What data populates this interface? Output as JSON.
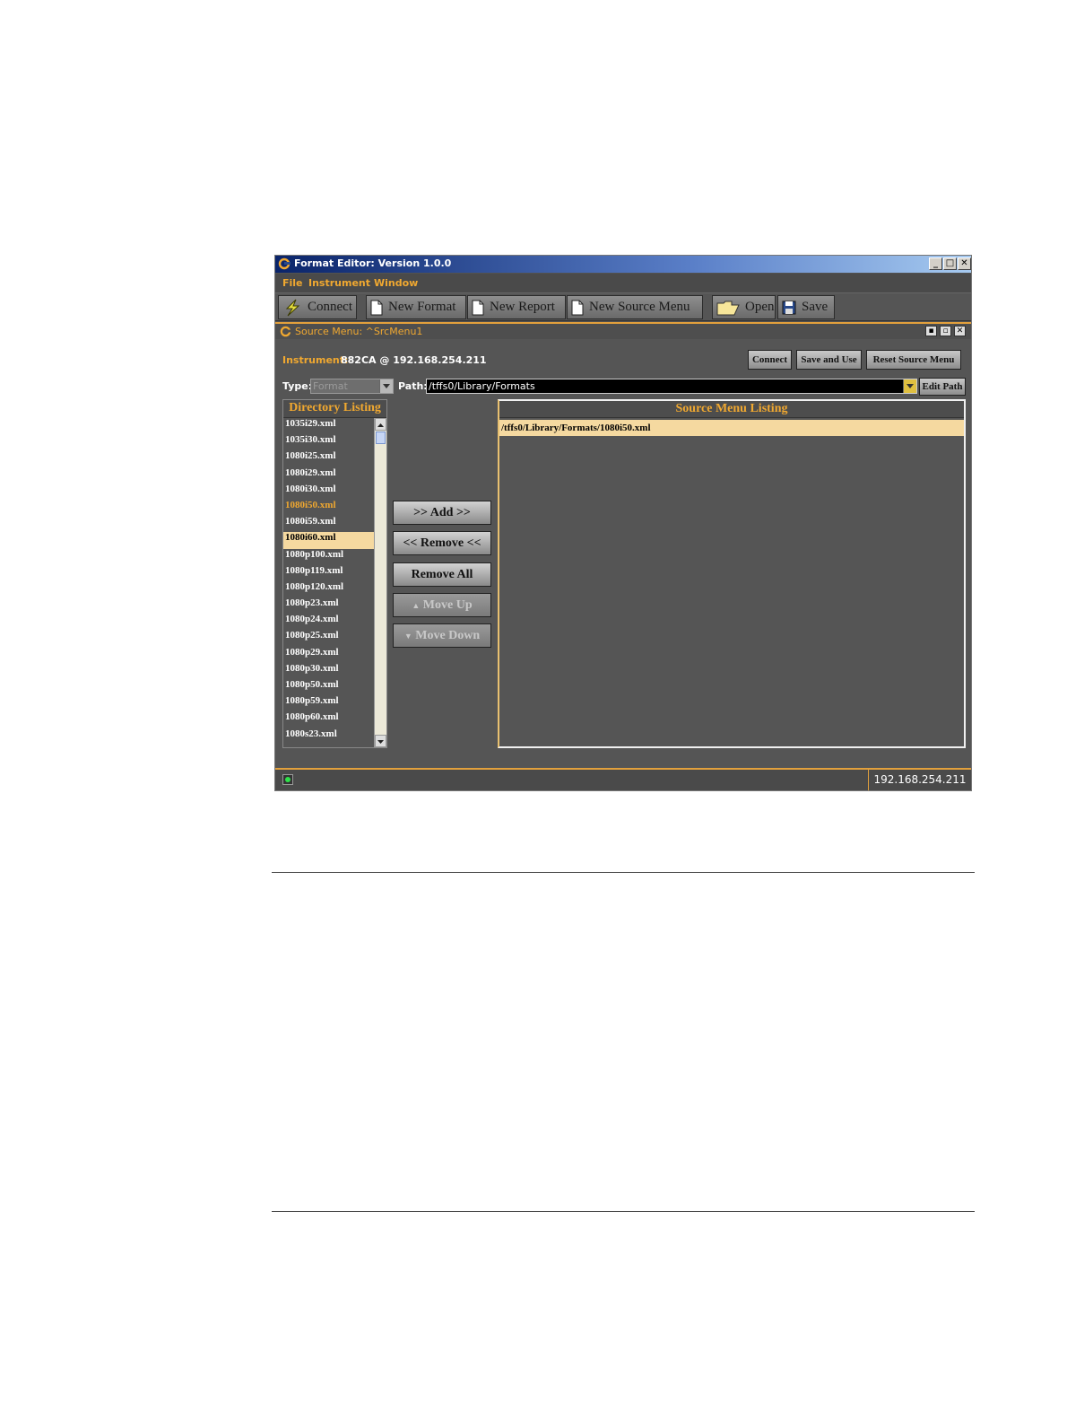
{
  "window": {
    "title": "Format Editor: Version 1.0.0",
    "controls": [
      "_",
      "□",
      "✕"
    ]
  },
  "menubar": {
    "items": [
      "File",
      "Instrument",
      "Window"
    ]
  },
  "toolbar": {
    "connect": "Connect",
    "new_format": "New Format",
    "new_report": "New Report",
    "new_source_menu": "New Source Menu",
    "open": "Open",
    "save": "Save"
  },
  "source_menu": {
    "title": "Source Menu:  ^SrcMenu1",
    "instrument_label": "Instrument:",
    "instrument_value": "882CA @ 192.168.254.211",
    "connect_button": "Connect",
    "save_and_use_button": "Save and Use",
    "reset_button": "Reset Source Menu",
    "type_label": "Type:",
    "type_value": "Format",
    "path_label": "Path:",
    "path_value": "/tffs0/Library/Formats",
    "edit_path_button": "Edit Path"
  },
  "directory_listing": {
    "header": "Directory Listing",
    "items": [
      "1035i29.xml",
      "1035i30.xml",
      "1080i25.xml",
      "1080i29.xml",
      "1080i30.xml",
      "1080i50.xml",
      "1080i59.xml",
      "1080i60.xml",
      "1080p100.xml",
      "1080p119.xml",
      "1080p120.xml",
      "1080p23.xml",
      "1080p24.xml",
      "1080p25.xml",
      "1080p29.xml",
      "1080p30.xml",
      "1080p50.xml",
      "1080p59.xml",
      "1080p60.xml",
      "1080s23.xml"
    ],
    "highlighted_index": 5,
    "selected_index": 7
  },
  "actions": {
    "add": ">> Add >>",
    "remove": "<< Remove <<",
    "remove_all": "Remove All",
    "move_up": "Move Up",
    "move_down": "Move Down"
  },
  "source_menu_listing": {
    "header": "Source Menu Listing",
    "items": [
      "/tffs0/Library/Formats/1080i50.xml"
    ]
  },
  "statusbar": {
    "ip": "192.168.254.211"
  },
  "colors": {
    "accent": "#f0a830",
    "panel": "#555555",
    "selection": "#f5d9a0"
  }
}
